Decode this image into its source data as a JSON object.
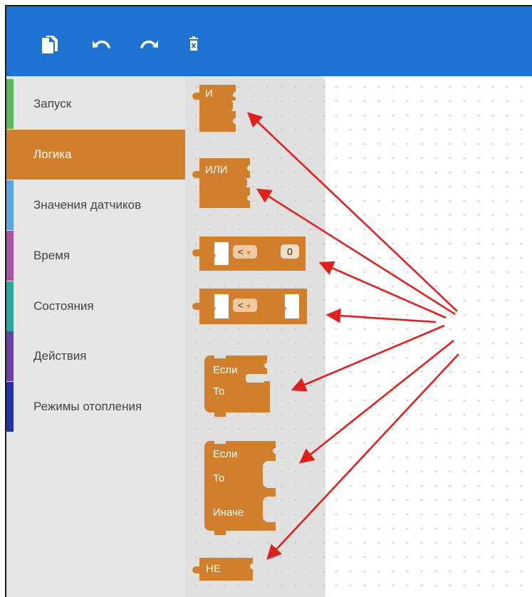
{
  "toolbar": {
    "buttons": [
      {
        "icon": "copy-icon"
      },
      {
        "icon": "undo-icon"
      },
      {
        "icon": "redo-icon"
      },
      {
        "icon": "delete-icon"
      }
    ]
  },
  "sidebar": {
    "items": [
      {
        "label": "Запуск",
        "color": "#5cb85c"
      },
      {
        "label": "Логика",
        "color": "#d27f2d",
        "active": true
      },
      {
        "label": "Значения датчиков",
        "color": "#5ba5e3"
      },
      {
        "label": "Время",
        "color": "#a553a0"
      },
      {
        "label": "Состояния",
        "color": "#2ca89a"
      },
      {
        "label": "Действия",
        "color": "#6a42a5"
      },
      {
        "label": "Режимы отопления",
        "color": "#2233aa"
      }
    ]
  },
  "blocks": {
    "and_label": "И",
    "or_label": "ИЛИ",
    "compare_number": {
      "operator": "<",
      "value": "0"
    },
    "compare_blocks": {
      "operator": "<"
    },
    "if_then": {
      "if_label": "Если",
      "then_label": "То"
    },
    "if_then_else": {
      "if_label": "Если",
      "then_label": "То",
      "else_label": "Иначе"
    },
    "not_label": "НЕ"
  },
  "colors": {
    "toolbar": "#1e73d2",
    "logic_block": "#d27f2d",
    "annotation_arrow": "#e0201b"
  }
}
